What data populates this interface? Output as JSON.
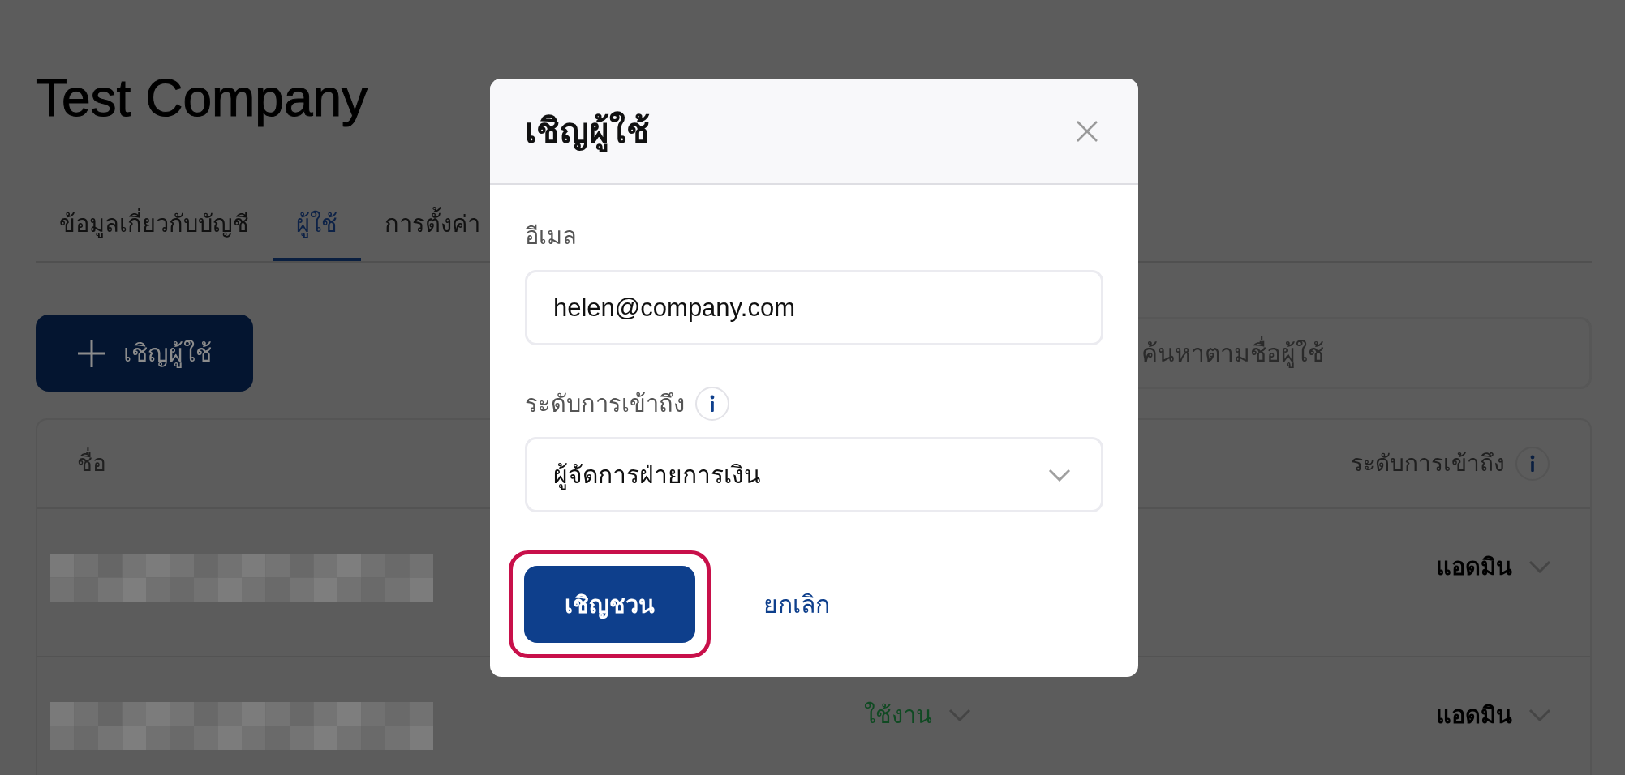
{
  "page": {
    "title": "Test Company"
  },
  "tabs": [
    {
      "label": "ข้อมูลเกี่ยวกับบัญชี",
      "selected": false
    },
    {
      "label": "ผู้ใช้",
      "selected": true
    },
    {
      "label": "การตั้งค่า",
      "selected": false
    }
  ],
  "toolbar": {
    "invite_button": {
      "label": "เชิญผู้ใช้"
    },
    "search": {
      "placeholder": "ค้นหาตามชื่อผู้ใช้"
    }
  },
  "table": {
    "columns": [
      {
        "label": "ชื่อ",
        "info": false
      },
      {
        "label": "ระดับการเข้าถึง",
        "info": true
      }
    ],
    "rows": [
      {
        "access": "แอดมิน"
      },
      {
        "status": "ใช้งาน",
        "access": "แอดมิน"
      }
    ]
  },
  "modal": {
    "title": "เชิญผู้ใช้",
    "email": {
      "label": "อีเมล",
      "value": "helen@company.com"
    },
    "access": {
      "label": "ระดับการเข้าถึง",
      "info": true,
      "value": "ผู้จัดการฝ่ายการเงิน"
    },
    "submit": {
      "label": "เชิญชวน",
      "highlighted": true
    },
    "cancel": {
      "label": "ยกเลิก"
    }
  }
}
